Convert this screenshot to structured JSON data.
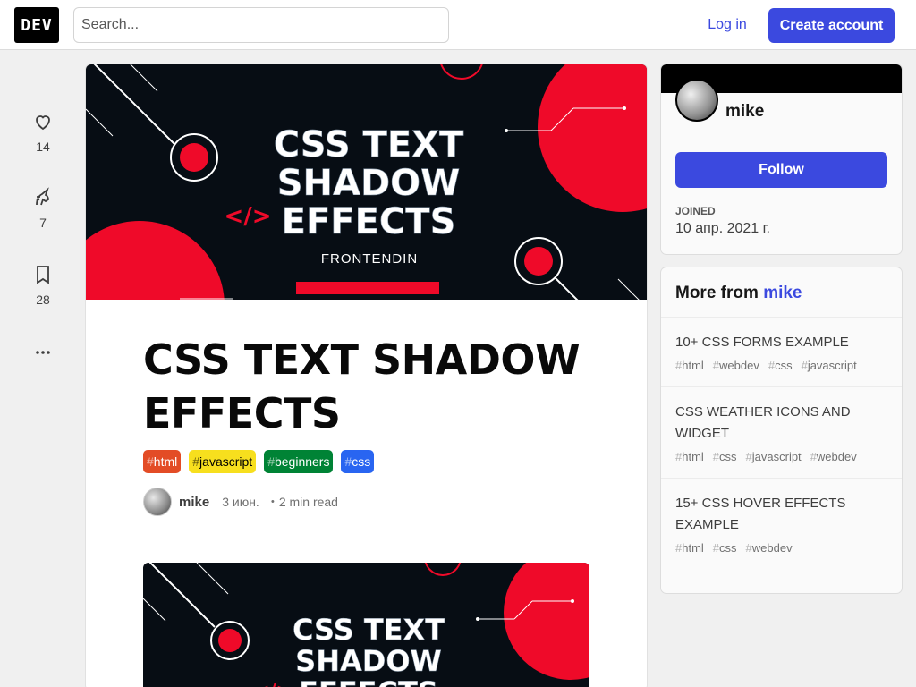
{
  "header": {
    "logo": "DEV",
    "search_placeholder": "Search...",
    "login_label": "Log in",
    "create_label": "Create account"
  },
  "reactions": [
    {
      "icon": "heart-icon",
      "count": "14"
    },
    {
      "icon": "unicorn-icon",
      "count": "7"
    },
    {
      "icon": "bookmark-icon",
      "count": "28"
    }
  ],
  "cover": {
    "line1": "CSS TEXT",
    "line2": "SHADOW",
    "line3": "EFFECTS",
    "brand": "FRONTENDIN",
    "colors": {
      "bg": "#070d14",
      "accent": "#ef0a29",
      "text": "#ffffff"
    }
  },
  "article": {
    "title": "CSS TEXT SHADOW EFFECTS",
    "tags": [
      {
        "name": "html",
        "bg": "#e34c26",
        "fg": "#ffffff"
      },
      {
        "name": "javascript",
        "bg": "#f7df1e",
        "fg": "#000000"
      },
      {
        "name": "beginners",
        "bg": "#008335",
        "fg": "#ffffff"
      },
      {
        "name": "css",
        "bg": "#2965f1",
        "fg": "#ffffff"
      }
    ],
    "author": "mike",
    "date": "3 июн.",
    "read_time": "・2 min read"
  },
  "sidebar": {
    "profile": {
      "name": "mike",
      "follow_label": "Follow",
      "joined_label": "Joined",
      "joined_value": "10 апр. 2021 г."
    },
    "more": {
      "heading_prefix": "More from",
      "heading_author": "mike",
      "items": [
        {
          "title": "10+ CSS FORMS EXAMPLE",
          "tags": [
            "html",
            "webdev",
            "css",
            "javascript"
          ]
        },
        {
          "title": "CSS WEATHER ICONS AND WIDGET",
          "tags": [
            "html",
            "css",
            "javascript",
            "webdev"
          ]
        },
        {
          "title": "15+ CSS HOVER EFFECTS EXAMPLE",
          "tags": [
            "html",
            "css",
            "webdev"
          ]
        }
      ]
    }
  },
  "colors": {
    "accent": "#3b49df",
    "page_bg": "#f0f0f0"
  }
}
